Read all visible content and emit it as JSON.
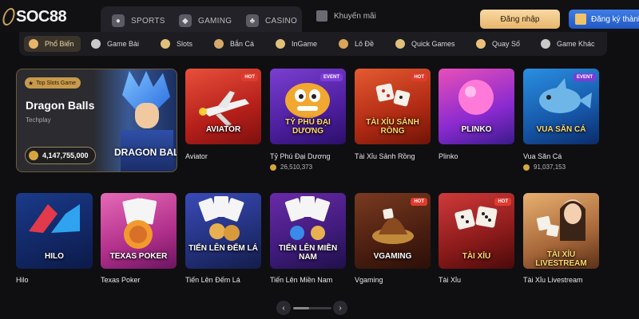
{
  "header": {
    "logo": "SOC88",
    "nav": [
      {
        "label": "SPORTS",
        "icon": "soccer-ball-icon"
      },
      {
        "label": "GAMING",
        "icon": "gamepad-icon"
      },
      {
        "label": "CASINO",
        "icon": "cards-icon"
      }
    ],
    "promo_label": "Khuyến mãi",
    "login_label": "Đăng nhập",
    "register_label": "Đăng ký thành viên"
  },
  "categories": [
    {
      "label": "Phổ Biến",
      "active": true,
      "color": "#e8b66b"
    },
    {
      "label": "Game Bài",
      "color": "#c9c9c9"
    },
    {
      "label": "Slots",
      "color": "#e0c07a"
    },
    {
      "label": "Bắn Cá",
      "color": "#d4a96a"
    },
    {
      "label": "InGame",
      "color": "#e0c07a"
    },
    {
      "label": "Lô Đề",
      "color": "#d9a35a"
    },
    {
      "label": "Quick Games",
      "color": "#e0c07a"
    },
    {
      "label": "Quay Số",
      "color": "#e8c27a"
    },
    {
      "label": "Game Khác",
      "color": "#c9c9c9"
    }
  ],
  "featured": {
    "badge": "Top Slots Game",
    "title": "Dragon Balls",
    "provider": "Techplay",
    "jackpot": "4,147,755,000",
    "art_logo": "DRAGON BALL"
  },
  "row1": [
    {
      "caption": "AVIATOR",
      "name": "Aviator",
      "badge": "HOT",
      "jackpot": null
    },
    {
      "caption": "TỶ PHÚ ĐẠI DƯƠNG",
      "name": "Tỷ Phú Đại Dương",
      "badge": "EVENT",
      "jackpot": "26,510,373"
    },
    {
      "caption": "TÀI XỈU SẢNH RỒNG",
      "name": "Tài Xỉu Sảnh Rồng",
      "badge": "HOT",
      "jackpot": null
    },
    {
      "caption": "PLINKO",
      "name": "Plinko",
      "badge": null,
      "jackpot": null
    },
    {
      "caption": "VUA SĂN CÁ",
      "name": "Vua Săn Cá",
      "badge": "EVENT",
      "jackpot": "91,037,153"
    }
  ],
  "row2": [
    {
      "caption": "HILO",
      "name": "Hilo",
      "badge": null
    },
    {
      "caption": "TEXAS POKER",
      "name": "Texas Poker",
      "badge": null
    },
    {
      "caption": "TIẾN LÊN ĐẾM LÁ",
      "name": "Tiến Lên Đếm Lá",
      "badge": null
    },
    {
      "caption": "TIẾN LÊN MIỀN NAM",
      "name": "Tiến Lên Miền Nam",
      "badge": null
    },
    {
      "caption": "VGAMING",
      "name": "Vgaming",
      "badge": "HOT"
    },
    {
      "caption": "TÀI XỈU",
      "name": "Tài Xỉu",
      "badge": "HOT"
    },
    {
      "caption": "TÀI XỈU LIVESTREAM",
      "name": "Tài Xỉu Livestream",
      "badge": null
    }
  ],
  "pager": {
    "prev": "‹",
    "next": "›"
  }
}
